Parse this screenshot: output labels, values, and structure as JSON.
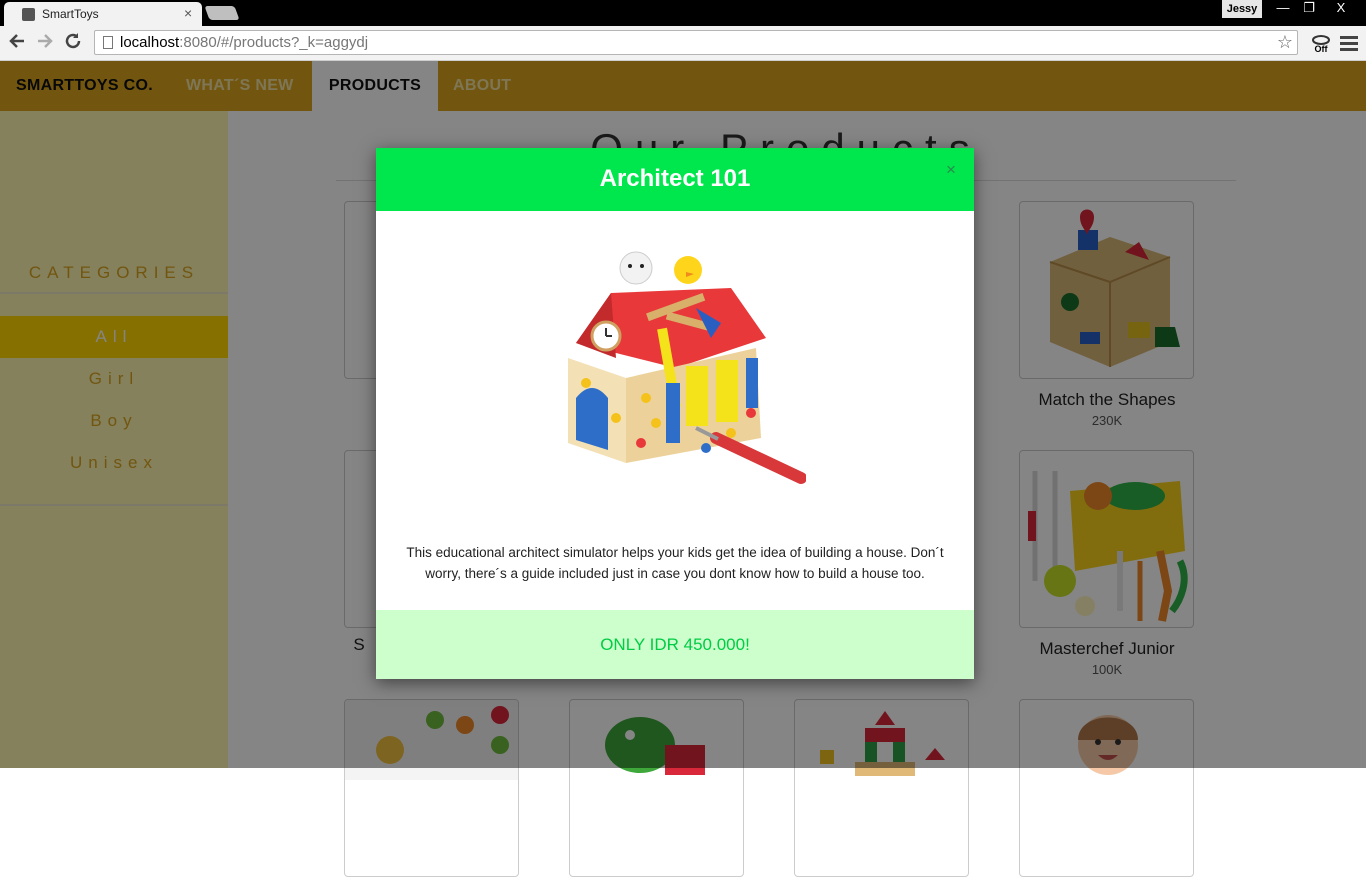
{
  "browser": {
    "tab_title": "SmartToys",
    "tab_close": "×",
    "profile_name": "Jessy",
    "url_host": "localhost",
    "url_path": ":8080/#/products?_k=aggydj",
    "window_buttons": {
      "minimize": "—",
      "restore": "❐",
      "close": "X"
    },
    "extension_label": "Off"
  },
  "nav": {
    "brand": "SMARTTOYS CO.",
    "items": [
      "WHAT´S NEW",
      "PRODUCTS",
      "ABOUT"
    ],
    "active": "PRODUCTS"
  },
  "sidebar": {
    "title": "CATEGORIES",
    "categories": [
      "All",
      "Girl",
      "Boy",
      "Unisex"
    ],
    "active": "All"
  },
  "main": {
    "heading": "Our Products",
    "products": [
      {
        "name": "Match the Shapes",
        "price": "230K"
      },
      {
        "name": "Masterchef Junior",
        "price": "100K"
      }
    ],
    "partial_label": "S"
  },
  "modal": {
    "title": "Architect 101",
    "close": "×",
    "description": "This educational architect simulator helps your kids get the idea of building a house. Don´t worry, there´s a guide included just in case you dont know how to build a house too.",
    "price": "ONLY IDR 450.000!"
  },
  "colors": {
    "nav_bg": "#daa520",
    "sidebar_bg": "#fff7b0",
    "active_category": "#ffd700",
    "modal_header": "#00e64d",
    "modal_footer": "#ccffcc",
    "price_text": "#00cc44"
  }
}
